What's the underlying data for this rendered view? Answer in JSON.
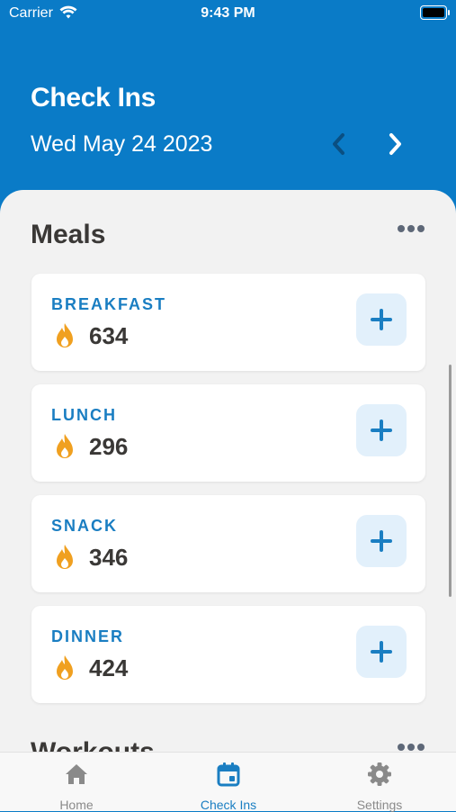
{
  "status_bar": {
    "carrier": "Carrier",
    "time": "9:43 PM"
  },
  "header": {
    "title": "Check Ins",
    "date": "Wed May 24 2023"
  },
  "meals_section": {
    "title": "Meals",
    "items": [
      {
        "label": "BREAKFAST",
        "calories": "634"
      },
      {
        "label": "LUNCH",
        "calories": "296"
      },
      {
        "label": "SNACK",
        "calories": "346"
      },
      {
        "label": "DINNER",
        "calories": "424"
      }
    ]
  },
  "workouts_section": {
    "title": "Workouts"
  },
  "tab_bar": {
    "tabs": [
      {
        "label": "Home",
        "icon": "home-icon",
        "active": false
      },
      {
        "label": "Check Ins",
        "icon": "calendar-icon",
        "active": true
      },
      {
        "label": "Settings",
        "icon": "gear-icon",
        "active": false
      }
    ]
  },
  "colors": {
    "header_bg": "#0a7bc7",
    "accent": "#1a7ec2",
    "flame": "#f0a020",
    "sheet_bg": "#f2f2f2"
  }
}
